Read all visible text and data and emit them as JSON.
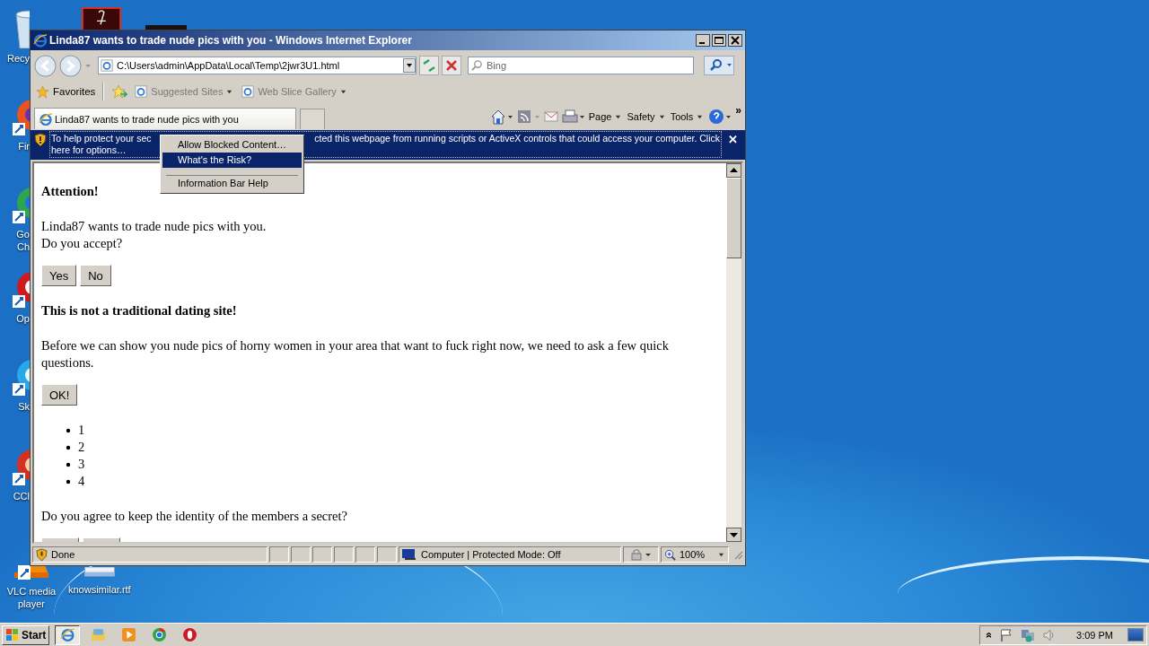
{
  "desktop": {
    "icons": [
      {
        "kind": "recycle",
        "lines": [
          "Recy"
        ]
      },
      {
        "kind": "firefox",
        "lines": [
          "Fir"
        ]
      },
      {
        "kind": "chrome",
        "lines": [
          "Go",
          "Ch"
        ]
      },
      {
        "kind": "opera",
        "lines": [
          "Op"
        ]
      },
      {
        "kind": "skype",
        "lines": [
          "Sk"
        ]
      },
      {
        "kind": "ccleaner",
        "lines": [
          "CCl"
        ]
      },
      {
        "kind": "vlc",
        "lines": [
          "VLC media",
          "player"
        ]
      }
    ],
    "file_icon": {
      "label": "knowsimilar.rtf"
    }
  },
  "window": {
    "title": "Linda87 wants to trade nude pics with you - Windows Internet Explorer",
    "address": "C:\\Users\\admin\\AppData\\Local\\Temp\\2jwr3U1.html",
    "search": {
      "placeholder": "Bing"
    },
    "favorites": "Favorites",
    "links": [
      "Suggested Sites",
      "Web Slice Gallery"
    ],
    "tab": {
      "label": "Linda87 wants to trade nude pics with you",
      "selected": true
    },
    "commands": [
      "Page",
      "Safety",
      "Tools"
    ],
    "more": "»",
    "info_bar": {
      "left": "To help protect your sec",
      "right": "cted this webpage from running scripts or ActiveX controls that could access your computer. Click",
      "second_line": "here for options…",
      "close": "✕"
    },
    "context_menu": [
      {
        "label": "Allow Blocked Content…",
        "selected": false,
        "separator_before": false
      },
      {
        "label": "What's the Risk?",
        "selected": true,
        "separator_before": false
      },
      {
        "label": "Information Bar Help",
        "selected": false,
        "separator_before": true
      }
    ],
    "page": [
      {
        "kind": "heading",
        "text": "Attention!"
      },
      {
        "kind": "paragraph",
        "lines": [
          "Linda87 wants to trade nude pics with you.",
          "Do you accept?"
        ]
      },
      {
        "kind": "buttons",
        "buttons": [
          "Yes",
          "No"
        ]
      },
      {
        "kind": "heading",
        "text": "This is not a traditional dating site!"
      },
      {
        "kind": "paragraph",
        "lines": [
          "Before we can show you nude pics of horny women in your area that want to fuck right now, we need to ask a few quick questions."
        ]
      },
      {
        "kind": "buttons",
        "buttons": [
          "OK!"
        ]
      },
      {
        "kind": "list",
        "items": [
          "1",
          "2",
          "3",
          "4"
        ]
      },
      {
        "kind": "paragraph",
        "lines": [
          "Do you agree to keep the identity of the members a secret?"
        ]
      },
      {
        "kind": "cut_buttons"
      }
    ],
    "status": {
      "text": "Done",
      "zone": "Computer | Protected Mode: Off",
      "zoom": "100%"
    }
  },
  "taskbar": {
    "start": "Start",
    "apps": [
      {
        "kind": "ie",
        "selected": true
      },
      {
        "kind": "folder",
        "selected": false
      },
      {
        "kind": "media",
        "selected": false
      },
      {
        "kind": "chrome",
        "selected": false
      },
      {
        "kind": "opera",
        "selected": false
      }
    ],
    "tray_chevron": "»",
    "clock": "3:09 PM"
  }
}
